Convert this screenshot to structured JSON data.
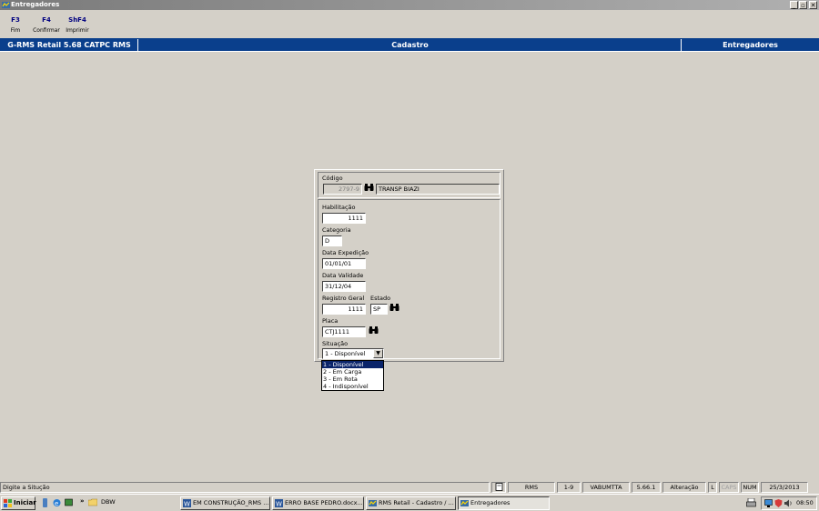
{
  "window": {
    "title": "Entregadores",
    "controls": {
      "minimize": "_",
      "maximize": "▫",
      "close": "✕"
    }
  },
  "toolbar": {
    "keys": [
      {
        "key": "F3",
        "label": "Fim"
      },
      {
        "key": "F4",
        "label": "Confirmar"
      },
      {
        "key": "ShF4",
        "label": "Imprimir"
      }
    ]
  },
  "header": {
    "app": "G-RMS Retail 5.68 CATPC RMS",
    "section": "Cadastro",
    "screen": "Entregadores"
  },
  "form": {
    "codigo": {
      "label": "Código",
      "value": "2797-9",
      "description": "TRANSP BIAZI"
    },
    "habilitacao": {
      "label": "Habilitação",
      "value": "1111"
    },
    "categoria": {
      "label": "Categoria",
      "value": "D"
    },
    "data_expedicao": {
      "label": "Data Expedição",
      "value": "01/01/01"
    },
    "data_validade": {
      "label": "Data Validade",
      "value": "31/12/04"
    },
    "registro_geral": {
      "label": "Registro Geral",
      "value": "1111"
    },
    "estado": {
      "label": "Estado",
      "value": "SP"
    },
    "placa": {
      "label": "Placa",
      "value": "CTJ1111"
    },
    "situacao": {
      "label": "Situação",
      "value": "1 - Disponível",
      "options": [
        "1 - Disponível",
        "2 - Em Carga",
        "3 - Em Rota",
        "4 - Indisponível"
      ]
    }
  },
  "statusbar": {
    "message": "Digite a Situção",
    "cells": [
      "RMS",
      "1-9",
      "VABUMTTA",
      "5.66.1",
      "Alteração",
      "L",
      "CAPS",
      "NUM",
      "25/3/2013"
    ]
  },
  "taskbar": {
    "start": "Iniciar",
    "overflow": "»",
    "folder": "DBW",
    "buttons": [
      "EM CONSTRUÇÃO_RMS ...",
      "ERRO BASE PEDRO.docx...",
      "RMS Retail - Cadastro / ...",
      "Entregadores"
    ],
    "clock": "08:50"
  },
  "colors": {
    "header_blue": "#0a3f8c",
    "selection": "#0a246a",
    "face": "#d4d0c8"
  }
}
